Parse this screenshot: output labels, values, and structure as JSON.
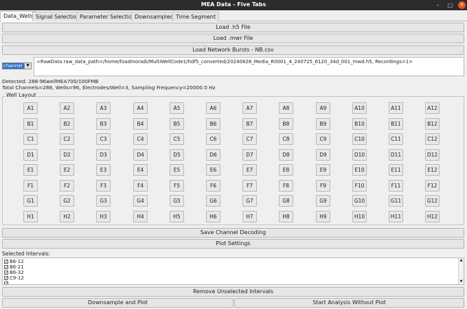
{
  "window": {
    "title": "MEA Data - Five Tabs"
  },
  "tabs": [
    "Data_Wells",
    "Signal Selection",
    "Parameter Selection",
    "Downsampled",
    "Time Segment"
  ],
  "buttons": {
    "load_h5": "Load .h5 File",
    "load_mwr": "Load .mwr File",
    "load_network_bursts": "Load Network Bursts - NB.csv",
    "save_channel_decoding": "Save Channel Decoding",
    "plot_settings": "Plot Settings",
    "remove_unselected": "Remove Unselected Intervals",
    "downsample_plot": "Downsample and Plot",
    "start_analysis": "Start Analysis Without Plot"
  },
  "channel_select": {
    "selected": "channel"
  },
  "raw_data_text": "<RawData raw_data_path=/home/foadmoradi/MultiWellCode1/hdf5_converted/20240828_Media_R0001_4_240725_6120_34d_001_mwd.h5, Recordings=1>",
  "detected": {
    "line1": "Detected: 288-96wellMEA700/100FMB",
    "line2": "Total Channels=288,  Wells=96,  Electrodes/Well=3,  Sampling Frequency=20000.0 Hz"
  },
  "well_layout": {
    "title": "Well Layout",
    "rows": [
      "A",
      "B",
      "C",
      "D",
      "E",
      "F",
      "G",
      "H"
    ],
    "columns": [
      "1",
      "2",
      "3",
      "4",
      "5",
      "6",
      "7",
      "8",
      "9",
      "10",
      "11",
      "12"
    ]
  },
  "intervals": {
    "label": "Selected Intervals:",
    "items": [
      {
        "label": "B6-12",
        "checked": true
      },
      {
        "label": "B6-21",
        "checked": true
      },
      {
        "label": "B6-32",
        "checked": true
      },
      {
        "label": "C9-12",
        "checked": true
      }
    ]
  },
  "icons": {
    "minimize": "minimize-icon",
    "maximize": "maximize-icon",
    "close": "close-icon",
    "dropdown": "chevron-down-icon",
    "scroll_up": "arrow-up-icon",
    "scroll_down": "arrow-down-icon"
  },
  "colors": {
    "titlebar": "#2c2c2c",
    "close_button": "#e95420",
    "selection": "#2a6fc9"
  }
}
